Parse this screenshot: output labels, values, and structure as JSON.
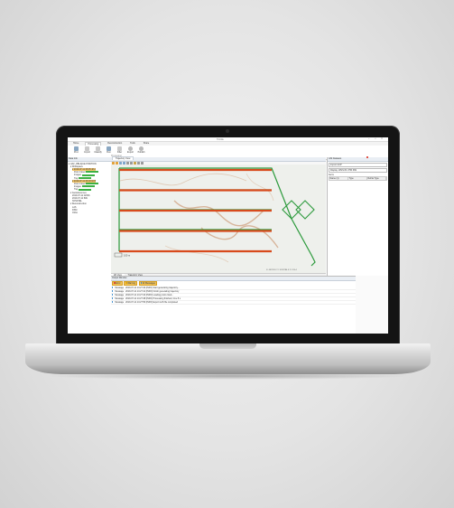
{
  "app": {
    "title": "Trimble",
    "window_controls": [
      "–",
      "□",
      "✕"
    ],
    "menu": [
      "Home",
      "Processing",
      "Reconstruction",
      "Tools",
      "Share"
    ],
    "active_menu": "Processing",
    "ribbon_buttons": [
      {
        "label": "Proc",
        "icon": "process-icon"
      },
      {
        "label": "Import",
        "icon": "import-icon"
      },
      {
        "label": "Classify",
        "icon": "classify-icon"
      },
      {
        "label": "Run",
        "icon": "run-icon"
      },
      {
        "label": "Filter",
        "icon": "filter-icon"
      },
      {
        "label": "Export",
        "icon": "export-icon"
      },
      {
        "label": "Publish",
        "icon": "publish-icon"
      }
    ],
    "ribbon_group": "Processing"
  },
  "project_explorer": {
    "header": "Data Info",
    "items": [
      {
        "label": "▾ UAV_OBLIQUE POSITION",
        "level": 0,
        "highlight": false,
        "bar": false
      },
      {
        "label": "▾ Workspace",
        "level": 1,
        "highlight": false,
        "bar": false
      },
      {
        "label": "▾ 2019-07-11 08:05:48 A",
        "level": 2,
        "highlight": true,
        "bar": false
      },
      {
        "label": "Point Cloud",
        "level": 3,
        "highlight": false,
        "bar": true
      },
      {
        "label": "Images",
        "level": 3,
        "highlight": false,
        "bar": true
      },
      {
        "label": "Traj",
        "level": 3,
        "highlight": false,
        "bar": true
      },
      {
        "label": "▾ 2019-07-11 09:18:02 B",
        "level": 2,
        "highlight": true,
        "bar": false
      },
      {
        "label": "Point Cloud",
        "level": 3,
        "highlight": false,
        "bar": true
      },
      {
        "label": "Images",
        "level": 3,
        "highlight": false,
        "bar": true
      },
      {
        "label": "Traj",
        "level": 3,
        "highlight": false,
        "bar": true
      },
      {
        "label": "▾ Georeferences",
        "level": 1,
        "highlight": false,
        "bar": false
      },
      {
        "label": "2019-07-11 GNSS",
        "level": 2,
        "highlight": false,
        "bar": false
      },
      {
        "label": "2019-07-11 IMU",
        "level": 2,
        "highlight": false,
        "bar": false
      },
      {
        "label": "NOVATEL",
        "level": 2,
        "highlight": false,
        "bar": false
      },
      {
        "label": "▾ Reconstruction",
        "level": 1,
        "highlight": false,
        "bar": false
      },
      {
        "label": "LAS",
        "level": 2,
        "highlight": false,
        "bar": false
      },
      {
        "label": "DSM",
        "level": 2,
        "highlight": false,
        "bar": false
      },
      {
        "label": "Ortho",
        "level": 2,
        "highlight": false,
        "bar": false
      }
    ]
  },
  "map_view": {
    "tab_label": "Trajectory View",
    "coordinate_readout": "X: 452311.2 Y: 5126784.5 Z: 120.4",
    "scale_label": "100 m",
    "view_tabs": [
      "2D View",
      "Trajectory View"
    ],
    "flight_lines": 5,
    "colors": {
      "flight_line": "#d84a1c",
      "transit": "#2c9a3c",
      "terrain": "#d7b49a",
      "background": "#eef0ec"
    }
  },
  "output": {
    "header": "Output Window",
    "filters": [
      {
        "label": "Error",
        "color": "#d9342b"
      },
      {
        "label": "Warning",
        "color": "#e0a300"
      },
      {
        "label": "42 Messages",
        "color": "#2d84c9"
      }
    ],
    "messages": [
      {
        "type": "Message",
        "time": "2019-07-11 14:27:40",
        "text": "2019-07-11 14:27:40 [INFO] Start generating trajectory..."
      },
      {
        "type": "Message",
        "time": "2019-07-11 14:27:41",
        "text": "2019-07-11 14:27:41 [INFO] Finish generating trajectory"
      },
      {
        "type": "Message",
        "time": "2019-07-11 14:27:44",
        "text": "2019-07-11 14:27:44 [INFO] Loading point cloud..."
      },
      {
        "type": "Message",
        "time": "2019-07-11 14:27:48",
        "text": "2019-07-11 14:27:48 [INFO] Processing finished, time 8 s"
      },
      {
        "type": "Message",
        "time": "2019-07-11 14:27:50",
        "text": "2019-07-11 14:27:50 [INFO] Export LAS file completed"
      }
    ]
  },
  "properties": {
    "header": "GIS Datasets",
    "search_value": "Import GCP",
    "filter_value": "Display: WGS 84 UTM 33N",
    "section": "Items",
    "columns": [
      "Name (1)",
      "Type",
      "Ref/ta Type"
    ]
  }
}
